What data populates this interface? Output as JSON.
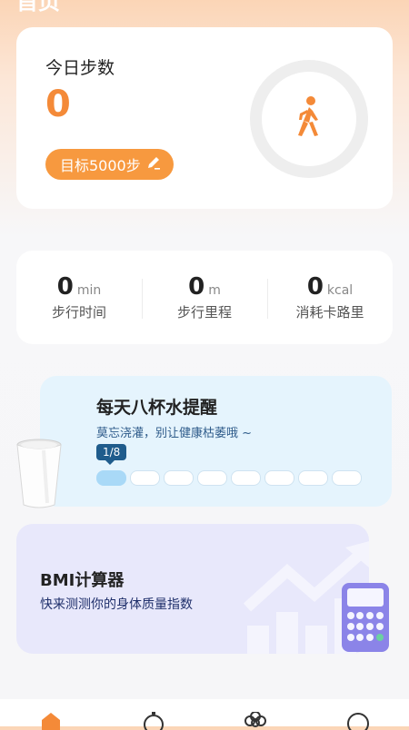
{
  "header": {
    "title": "首页"
  },
  "steps": {
    "label": "今日步数",
    "value": "0",
    "goal_label": "目标5000步",
    "icon": "walking-person-icon",
    "accent": "#f48a38"
  },
  "stats": [
    {
      "value": "0",
      "unit": "min",
      "label": "步行时间"
    },
    {
      "value": "0",
      "unit": "m",
      "label": "步行里程"
    },
    {
      "value": "0",
      "unit": "kcal",
      "label": "消耗卡路里"
    }
  ],
  "water": {
    "title": "每天八杯水提醒",
    "subtitle": "莫忘浇灌，别让健康枯萎哦 ~",
    "progress_label": "1/8",
    "filled": 1,
    "total": 8
  },
  "bmi": {
    "title": "BMI计算器",
    "subtitle": "快来测测你的身体质量指数"
  },
  "nav": [
    {
      "icon": "home-icon",
      "active": true
    },
    {
      "icon": "timer-icon",
      "active": false
    },
    {
      "icon": "flower-icon",
      "active": false
    },
    {
      "icon": "profile-icon",
      "active": false
    }
  ]
}
